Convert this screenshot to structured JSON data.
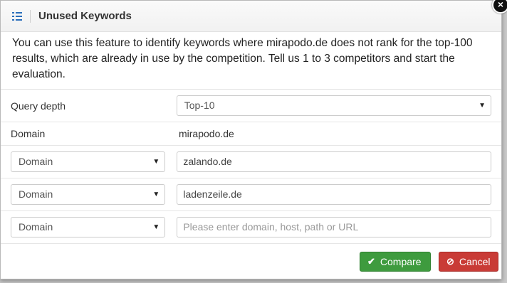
{
  "dialog": {
    "title": "Unused Keywords",
    "close_glyph": "×",
    "intro": "You can use this feature to identify keywords where mirapodo.de does not rank for the top-100 results, which are already in use by the competition. Tell us 1 to 3 competitors and start the evaluation."
  },
  "query_depth": {
    "label": "Query depth",
    "selected": "Top-10"
  },
  "domain": {
    "label": "Domain",
    "value": "mirapodo.de"
  },
  "competitors": [
    {
      "type": "Domain",
      "value": "zalando.de",
      "placeholder": ""
    },
    {
      "type": "Domain",
      "value": "ladenzeile.de",
      "placeholder": ""
    },
    {
      "type": "Domain",
      "value": "",
      "placeholder": "Please enter domain, host, path or URL"
    }
  ],
  "buttons": {
    "compare": "Compare",
    "cancel": "Cancel"
  },
  "icons": {
    "header": "list-icon",
    "compare": "check-icon",
    "cancel": "ban-icon",
    "close": "close-icon",
    "dropdown": "caret-down-icon"
  },
  "colors": {
    "compare": "#3e9b3e",
    "cancel": "#c93b36",
    "header_icon": "#2a6ebb"
  }
}
